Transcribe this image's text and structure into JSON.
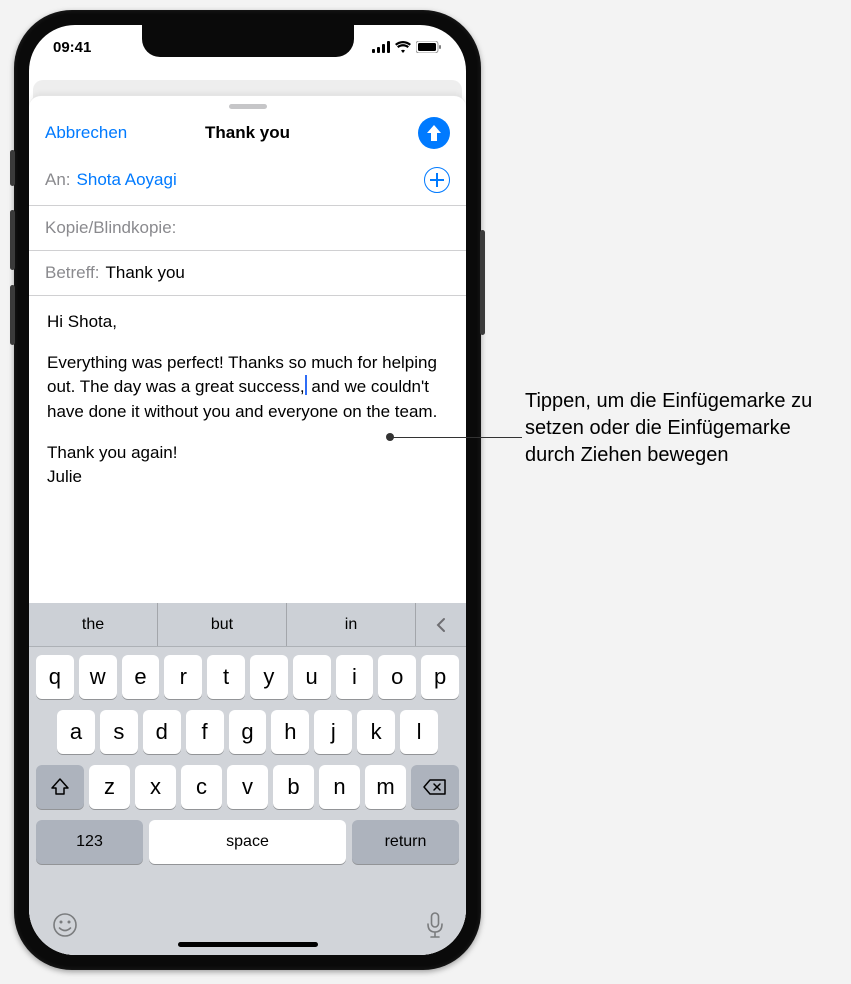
{
  "status": {
    "time": "09:41"
  },
  "compose": {
    "cancel": "Abbrechen",
    "title": "Thank you",
    "to_label": "An:",
    "to_value": "Shota Aoyagi",
    "cc_label": "Kopie/Blindkopie:",
    "subject_label": "Betreff:",
    "subject_value": "Thank you",
    "greeting": "Hi Shota,",
    "para1_a": "Everything was perfect! Thanks so much for helping out. The day was a great success,",
    "para1_b": " and we couldn't have done it without you and everyone on the team.",
    "closing": "Thank you again!",
    "signature": "Julie"
  },
  "keyboard": {
    "predictions": [
      "the",
      "but",
      "in"
    ],
    "row1": [
      "q",
      "w",
      "e",
      "r",
      "t",
      "y",
      "u",
      "i",
      "o",
      "p"
    ],
    "row2": [
      "a",
      "s",
      "d",
      "f",
      "g",
      "h",
      "j",
      "k",
      "l"
    ],
    "row3": [
      "z",
      "x",
      "c",
      "v",
      "b",
      "n",
      "m"
    ],
    "mode": "123",
    "space": "space",
    "return": "return"
  },
  "callout": {
    "text": "Tippen, um die Einfügemarke zu setzen oder die Einfügemarke durch Ziehen bewegen"
  }
}
